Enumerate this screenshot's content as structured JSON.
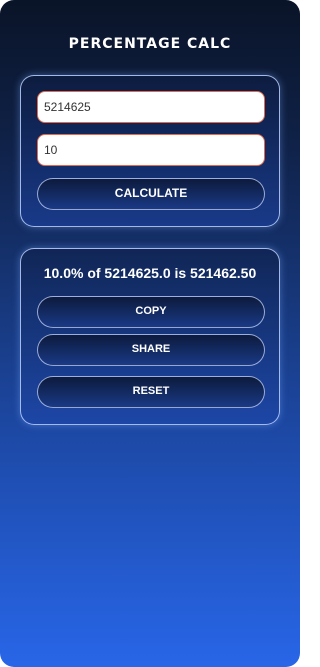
{
  "app": {
    "title": "PERCENTAGE CALC"
  },
  "inputs": {
    "amount_value": "5214625",
    "percent_value": "10"
  },
  "buttons": {
    "calculate": "CALCULATE",
    "copy": "COPY",
    "share": "SHARE",
    "reset": "RESET"
  },
  "result": {
    "text": "10.0% of 5214625.0 is 521462.50"
  },
  "colors": {
    "background_top": "#0a1428",
    "background_bottom": "#2866e8",
    "field_border": "#e56a4d",
    "card_border": "#bed2ff"
  }
}
